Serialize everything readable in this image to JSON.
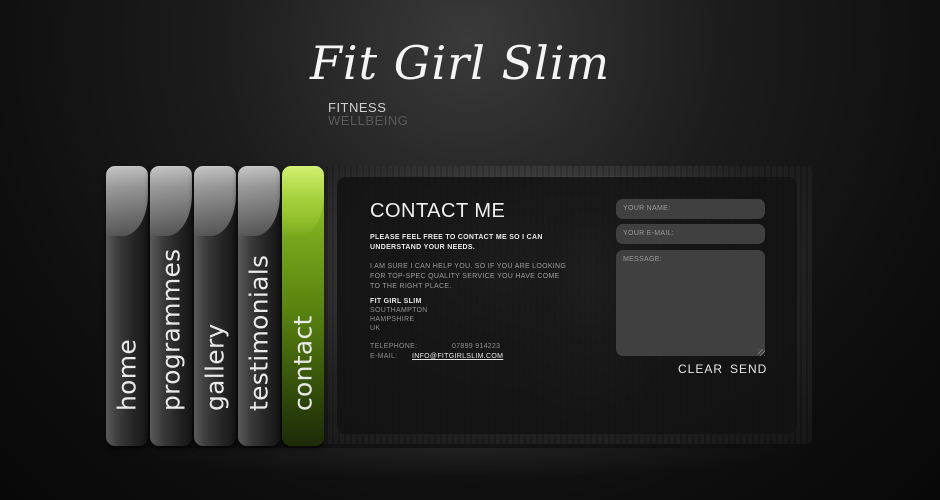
{
  "logo": {
    "text": "Fit Girl Slim",
    "tagline1": "FITNESS",
    "tagline2": "WELLBEING"
  },
  "nav": [
    {
      "label": "home",
      "active": false
    },
    {
      "label": "programmes",
      "active": false
    },
    {
      "label": "gallery",
      "active": false
    },
    {
      "label": "testimonials",
      "active": false
    },
    {
      "label": "contact",
      "active": true
    }
  ],
  "contact": {
    "title": "CONTACT ME",
    "intro": "PLEASE FEEL FREE TO CONTACT ME SO I CAN UNDERSTAND YOUR NEEDS.",
    "body": "I AM SURE I CAN HELP YOU. SO IF YOU ARE LOOKING FOR TOP-SPEC QUALITY SERVICE YOU HAVE COME TO THE RIGHT PLACE.",
    "address": {
      "name": "FIT GIRL SLIM",
      "line1": "SOUTHAMPTON",
      "line2": "HAMPSHIRE",
      "line3": "UK"
    },
    "telephone_label": "TELEPHONE:",
    "telephone": "07899 914223",
    "email_label": "E-MAIL:",
    "email": "INFO@FITGIRLSLIM.COM"
  },
  "form": {
    "name_placeholder": "YOUR NAME:",
    "email_placeholder": "YOUR E-MAIL:",
    "message_placeholder": "MESSAGE:",
    "clear_label": "CLEAR",
    "send_label": "SEND"
  },
  "colors": {
    "accent": "#8dbf2a",
    "background": "#111111"
  }
}
